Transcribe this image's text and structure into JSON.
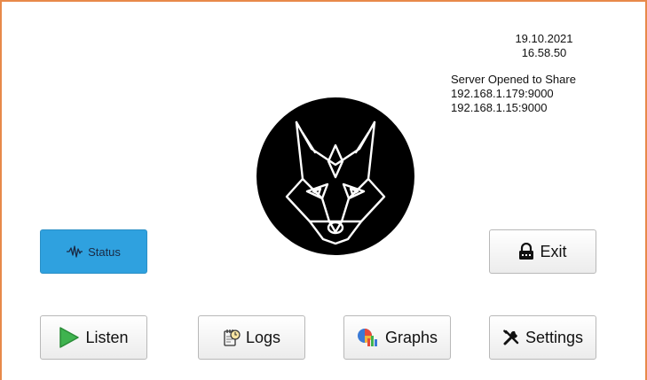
{
  "header": {
    "date": "19.10.2021",
    "time": "16.58.50"
  },
  "server": {
    "status": "Server Opened to Share",
    "addresses": [
      "192.168.1.179:9000",
      "192.168.1.15:9000"
    ]
  },
  "buttons": {
    "status": {
      "label": "Status",
      "icon": "waveform-icon",
      "bg_color": "#2fa1df"
    },
    "exit": {
      "label": "Exit",
      "icon": "lock-icon"
    },
    "listen": {
      "label": "Listen",
      "icon": "play-icon",
      "icon_color": "#3fb34f"
    },
    "logs": {
      "label": "Logs",
      "icon": "notepad-clock-icon"
    },
    "graphs": {
      "label": "Graphs",
      "icon": "chart-icon"
    },
    "settings": {
      "label": "Settings",
      "icon": "tools-icon"
    }
  },
  "logo": {
    "icon": "fox-logo-icon"
  },
  "colors": {
    "frame_border": "#e8894a",
    "accent": "#2fa1df"
  }
}
